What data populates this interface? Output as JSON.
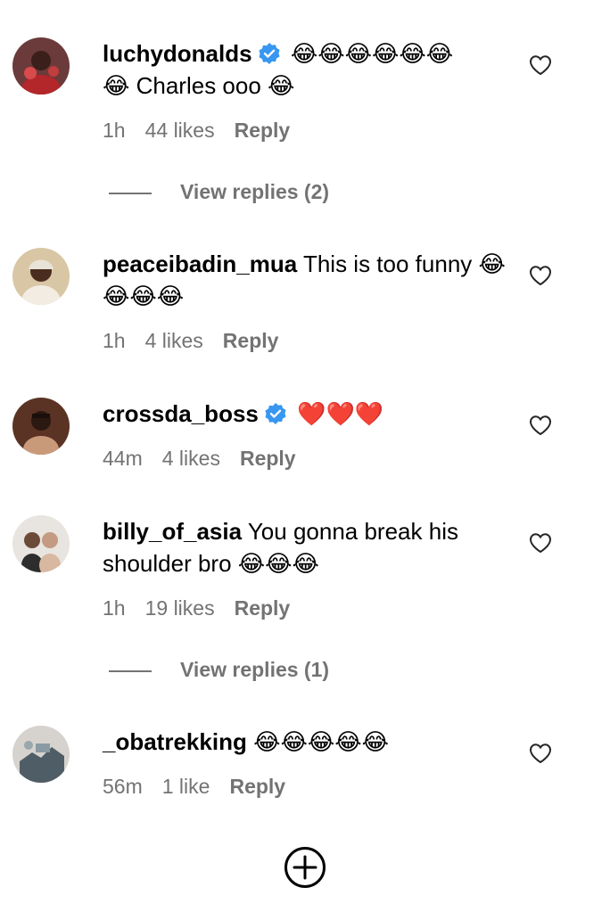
{
  "comments": [
    {
      "username": "luchydonalds",
      "verified": true,
      "text": "😂😂😂😂😂😂\n😂 Charles ooo 😂",
      "time": "1h",
      "likes": "44 likes",
      "reply_label": "Reply",
      "view_replies": "View replies (2)"
    },
    {
      "username": "peaceibadin_mua",
      "verified": false,
      "text": "This is too funny 😂😂😂😂",
      "time": "1h",
      "likes": "4 likes",
      "reply_label": "Reply"
    },
    {
      "username": "crossda_boss",
      "verified": true,
      "text": "❤️❤️❤️",
      "time": "44m",
      "likes": "4 likes",
      "reply_label": "Reply"
    },
    {
      "username": "billy_of_asia",
      "verified": false,
      "text": "You gonna break his shoulder bro 😂😂😂",
      "time": "1h",
      "likes": "19 likes",
      "reply_label": "Reply",
      "view_replies": "View replies (1)"
    },
    {
      "username": "_obatrekking",
      "verified": false,
      "text": "😂😂😂😂😂",
      "time": "56m",
      "likes": "1 like",
      "reply_label": "Reply"
    }
  ],
  "icons": {
    "like": "heart-outline-icon",
    "verified": "verified-badge-icon",
    "add": "plus-circle-icon"
  },
  "colors": {
    "verified_blue": "#3897f0",
    "meta_gray": "#737373"
  }
}
